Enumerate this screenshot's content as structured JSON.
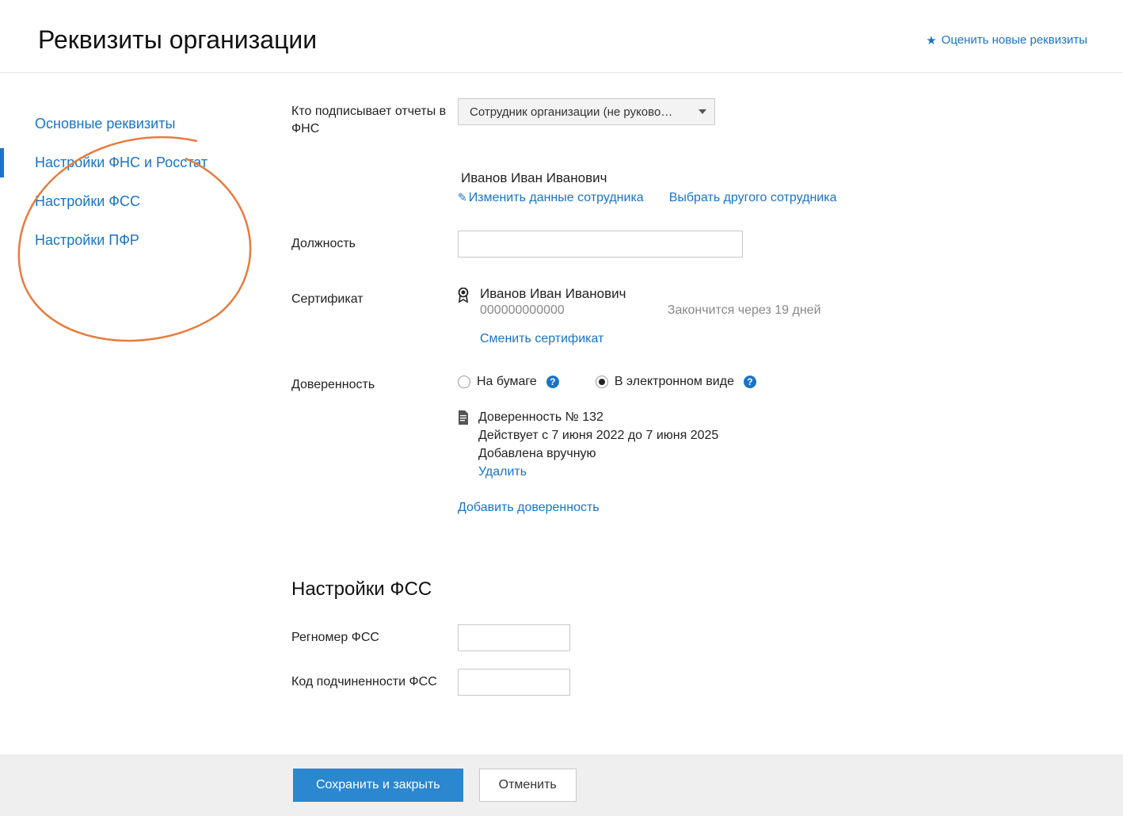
{
  "header": {
    "title": "Реквизиты организации",
    "rate_link": "Оценить новые реквизиты"
  },
  "sidebar": {
    "items": [
      {
        "label": "Основные реквизиты"
      },
      {
        "label": "Настройки ФНС и Росстат"
      },
      {
        "label": "Настройки ФСС"
      },
      {
        "label": "Настройки ПФР"
      }
    ]
  },
  "form": {
    "signer": {
      "label": "Кто подписывает отчеты в ФНС",
      "selected": "Сотрудник организации (не руково…",
      "employee_name": "Иванов Иван Иванович",
      "edit_link": "Изменить данные сотрудника",
      "choose_other_link": "Выбрать другого сотрудника"
    },
    "position": {
      "label": "Должность",
      "value": ""
    },
    "certificate": {
      "label": "Сертификат",
      "owner": "Иванов Иван Иванович",
      "serial": "000000000000",
      "expiry": "Закончится через 19 дней",
      "change_link": "Сменить сертификат"
    },
    "proxy": {
      "label": "Доверенность",
      "option_paper": "На бумаге",
      "option_electronic": "В электронном виде",
      "doc_title": "Доверенность № 132",
      "doc_validity": "Действует с 7 июня 2022 до 7 июня 2025",
      "doc_added": "Добавлена вручную",
      "delete_link": "Удалить",
      "add_link": "Добавить доверенность"
    },
    "fss_section": {
      "title": "Настройки ФСС",
      "reg_number_label": "Регномер ФСС",
      "reg_number_value": "",
      "sub_code_label": "Код подчиненности ФСС",
      "sub_code_value": ""
    }
  },
  "footer": {
    "save": "Сохранить и закрыть",
    "cancel": "Отменить"
  }
}
